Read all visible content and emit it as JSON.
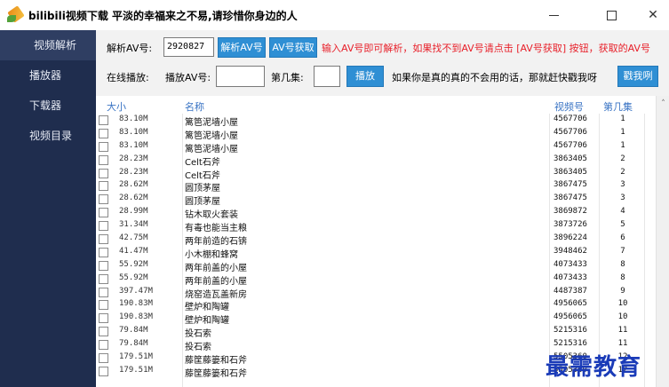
{
  "window": {
    "title": "bilibili视频下载 平淡的幸福来之不易,请珍惜你身边的人",
    "controls": {
      "minimize": "minimize-icon",
      "maximize": "maximize-icon",
      "close": "close-icon"
    }
  },
  "sidebar": {
    "items": [
      {
        "label": "视频解析",
        "active": true
      },
      {
        "label": "播放器",
        "active": false
      },
      {
        "label": "下载器",
        "active": false
      },
      {
        "label": "视频目录",
        "active": false
      }
    ]
  },
  "toolbar": {
    "av_label": "解析AV号:",
    "av_value": "2920827",
    "parse_button": "解析AV号",
    "fetch_button": "AV号获取",
    "red_hint": "输入AV号即可解析，如果找不到AV号请点击 [AV号获取] 按钮，获取的AV号",
    "online_label": "在线播放:",
    "play_av_label": "播放AV号:",
    "play_av_value": "",
    "episode_label": "第几集:",
    "episode_value": "",
    "play_button": "播放",
    "tip": "如果你是真的真的不会用的话，那就赶快戳我呀",
    "poke_button": "戳我咧"
  },
  "table": {
    "headers": {
      "size": "大小",
      "name": "名称",
      "av": "视频号",
      "episode": "第几集"
    },
    "rows": [
      {
        "size": "83.10M",
        "name": "篱笆泥墙小屋",
        "av": "4567706",
        "ep": "1"
      },
      {
        "size": "83.10M",
        "name": "篱笆泥墙小屋",
        "av": "4567706",
        "ep": "1"
      },
      {
        "size": "83.10M",
        "name": "篱笆泥墙小屋",
        "av": "4567706",
        "ep": "1"
      },
      {
        "size": "28.23M",
        "name": "Celt石斧",
        "av": "3863405",
        "ep": "2"
      },
      {
        "size": "28.23M",
        "name": "Celt石斧",
        "av": "3863405",
        "ep": "2"
      },
      {
        "size": "28.62M",
        "name": "圆顶茅屋",
        "av": "3867475",
        "ep": "3"
      },
      {
        "size": "28.62M",
        "name": "圆顶茅屋",
        "av": "3867475",
        "ep": "3"
      },
      {
        "size": "28.99M",
        "name": "钻木取火套装",
        "av": "3869872",
        "ep": "4"
      },
      {
        "size": "31.34M",
        "name": "有毒也能当主粮",
        "av": "3873726",
        "ep": "5"
      },
      {
        "size": "42.75M",
        "name": "两年前造的石锛",
        "av": "3896224",
        "ep": "6"
      },
      {
        "size": "41.47M",
        "name": "小木棚和蜂窝",
        "av": "3948462",
        "ep": "7"
      },
      {
        "size": "55.92M",
        "name": "两年前盖的小屋",
        "av": "4073433",
        "ep": "8"
      },
      {
        "size": "55.92M",
        "name": "两年前盖的小屋",
        "av": "4073433",
        "ep": "8"
      },
      {
        "size": "397.47M",
        "name": "烧窑造瓦盖新房",
        "av": "4487387",
        "ep": "9"
      },
      {
        "size": "190.83M",
        "name": "壁炉和陶罐",
        "av": "4956065",
        "ep": "10"
      },
      {
        "size": "190.83M",
        "name": "壁炉和陶罐",
        "av": "4956065",
        "ep": "10"
      },
      {
        "size": "79.84M",
        "name": "投石索",
        "av": "5215316",
        "ep": "11"
      },
      {
        "size": "79.84M",
        "name": "投石索",
        "av": "5215316",
        "ep": "11"
      },
      {
        "size": "179.51M",
        "name": "藤筐藤篓和石斧",
        "av": "5505360",
        "ep": "12"
      },
      {
        "size": "179.51M",
        "name": "藤筐藤篓和石斧",
        "av": "5505360",
        "ep": "12"
      }
    ]
  },
  "watermark": "最需教育",
  "colors": {
    "sidebar": "#1f2d4e",
    "accent_button": "#2f8fd4",
    "header_text": "#3a74c4",
    "hint_red": "#e8202a"
  }
}
